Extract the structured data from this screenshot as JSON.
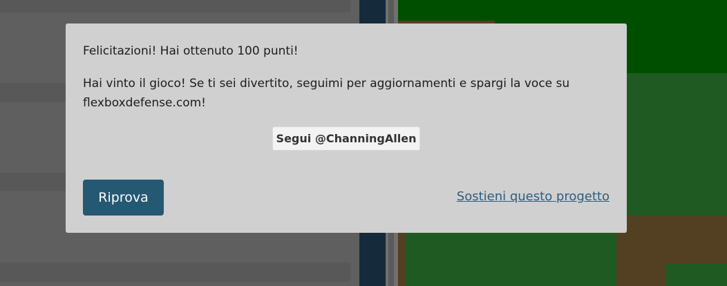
{
  "modal": {
    "message_score": "Felicitazioni! Hai ottenuto 100 punti!",
    "message_win": "Hai vinto il gioco! Se ti sei divertito, seguimi per aggiornamenti e spargi la voce su flexboxdefense.com!",
    "follow_button": "Segui @ChanningAllen",
    "retry_button": "Riprova",
    "support_link": "Sostieni questo progetto"
  },
  "colors": {
    "modal_bg": "#d0d0d0",
    "retry_button_bg": "#255873",
    "link": "#2d5d7f",
    "board_dark_green": "#004f00",
    "board_grass": "#1f5a22",
    "board_dirt": "#533f22"
  }
}
